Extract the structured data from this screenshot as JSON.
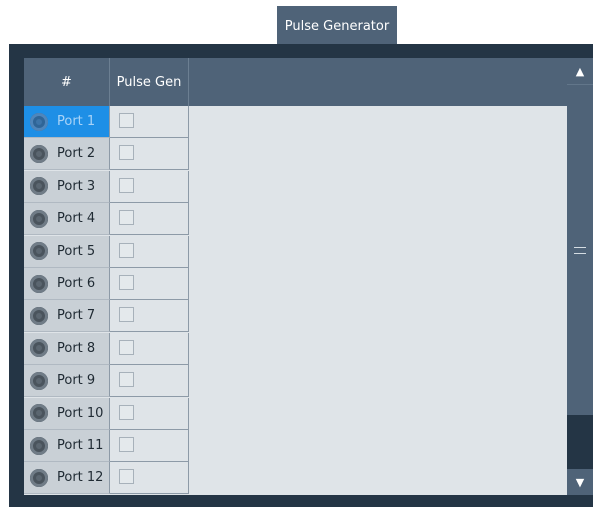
{
  "tab": {
    "label": "Pulse Generator"
  },
  "table": {
    "columns": {
      "number": "#",
      "pulse_gen": "Pulse Gen"
    },
    "rows": [
      {
        "port": "Port 1",
        "pulse_gen_checked": false,
        "selected": true
      },
      {
        "port": "Port 2",
        "pulse_gen_checked": false
      },
      {
        "port": "Port 3",
        "pulse_gen_checked": false
      },
      {
        "port": "Port 4",
        "pulse_gen_checked": false
      },
      {
        "port": "Port 5",
        "pulse_gen_checked": false
      },
      {
        "port": "Port 6",
        "pulse_gen_checked": false
      },
      {
        "port": "Port 7",
        "pulse_gen_checked": false
      },
      {
        "port": "Port 8",
        "pulse_gen_checked": false
      },
      {
        "port": "Port 9",
        "pulse_gen_checked": false
      },
      {
        "port": "Port 10",
        "pulse_gen_checked": false
      },
      {
        "port": "Port 11",
        "pulse_gen_checked": false
      },
      {
        "port": "Port 12",
        "pulse_gen_checked": false
      }
    ]
  },
  "icons": {
    "port": "port-connector-icon",
    "scroll_up": "arrow-up-icon",
    "scroll_down": "arrow-down-icon",
    "grip": "grip-lines-icon"
  },
  "colors": {
    "header": "#4f6378",
    "frame": "#243545",
    "selection": "#1e8fe6",
    "cell": "#dfe4e8"
  }
}
